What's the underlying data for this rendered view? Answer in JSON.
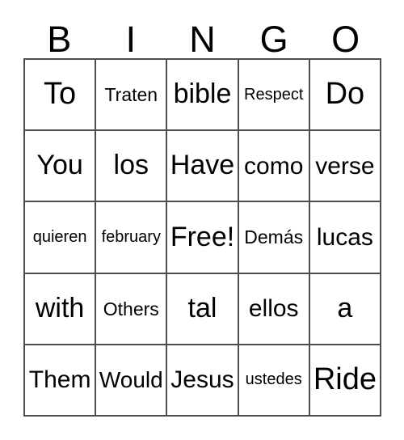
{
  "card": {
    "header_letters": [
      "B",
      "I",
      "N",
      "G",
      "O"
    ],
    "columns": [
      "B",
      "I",
      "N",
      "G",
      "O"
    ],
    "free_space": "Free!",
    "free_space_position": {
      "row": 3,
      "column": 3
    },
    "grid_size": "5x5",
    "border_color": "#4d4d4d",
    "background_color": "#ffffff",
    "text_color": "#000000",
    "rows": [
      [
        {
          "text": "To",
          "size": "xl"
        },
        {
          "text": "Traten",
          "size": "sm"
        },
        {
          "text": "bible",
          "size": "lg"
        },
        {
          "text": "Respect",
          "size": "xs"
        },
        {
          "text": "Do",
          "size": "xl"
        }
      ],
      [
        {
          "text": "You",
          "size": "lg"
        },
        {
          "text": "los",
          "size": "lg"
        },
        {
          "text": "Have",
          "size": "lg"
        },
        {
          "text": "como",
          "size": "md"
        },
        {
          "text": "verse",
          "size": "md"
        }
      ],
      [
        {
          "text": "quieren",
          "size": "xs"
        },
        {
          "text": "february",
          "size": "xs"
        },
        {
          "text": "Free!",
          "size": "lg"
        },
        {
          "text": "Demás",
          "size": "sm"
        },
        {
          "text": "lucas",
          "size": "md"
        }
      ],
      [
        {
          "text": "with",
          "size": "lg"
        },
        {
          "text": "Others",
          "size": "sm"
        },
        {
          "text": "tal",
          "size": "lg"
        },
        {
          "text": "ellos",
          "size": "md"
        },
        {
          "text": "a",
          "size": "lg"
        }
      ],
      [
        {
          "text": "Them",
          "size": "md"
        },
        {
          "text": "Would",
          "size": "md"
        },
        {
          "text": "Jesus",
          "size": "md"
        },
        {
          "text": "ustedes",
          "size": "xs"
        },
        {
          "text": "Ride",
          "size": "xl"
        }
      ]
    ]
  }
}
